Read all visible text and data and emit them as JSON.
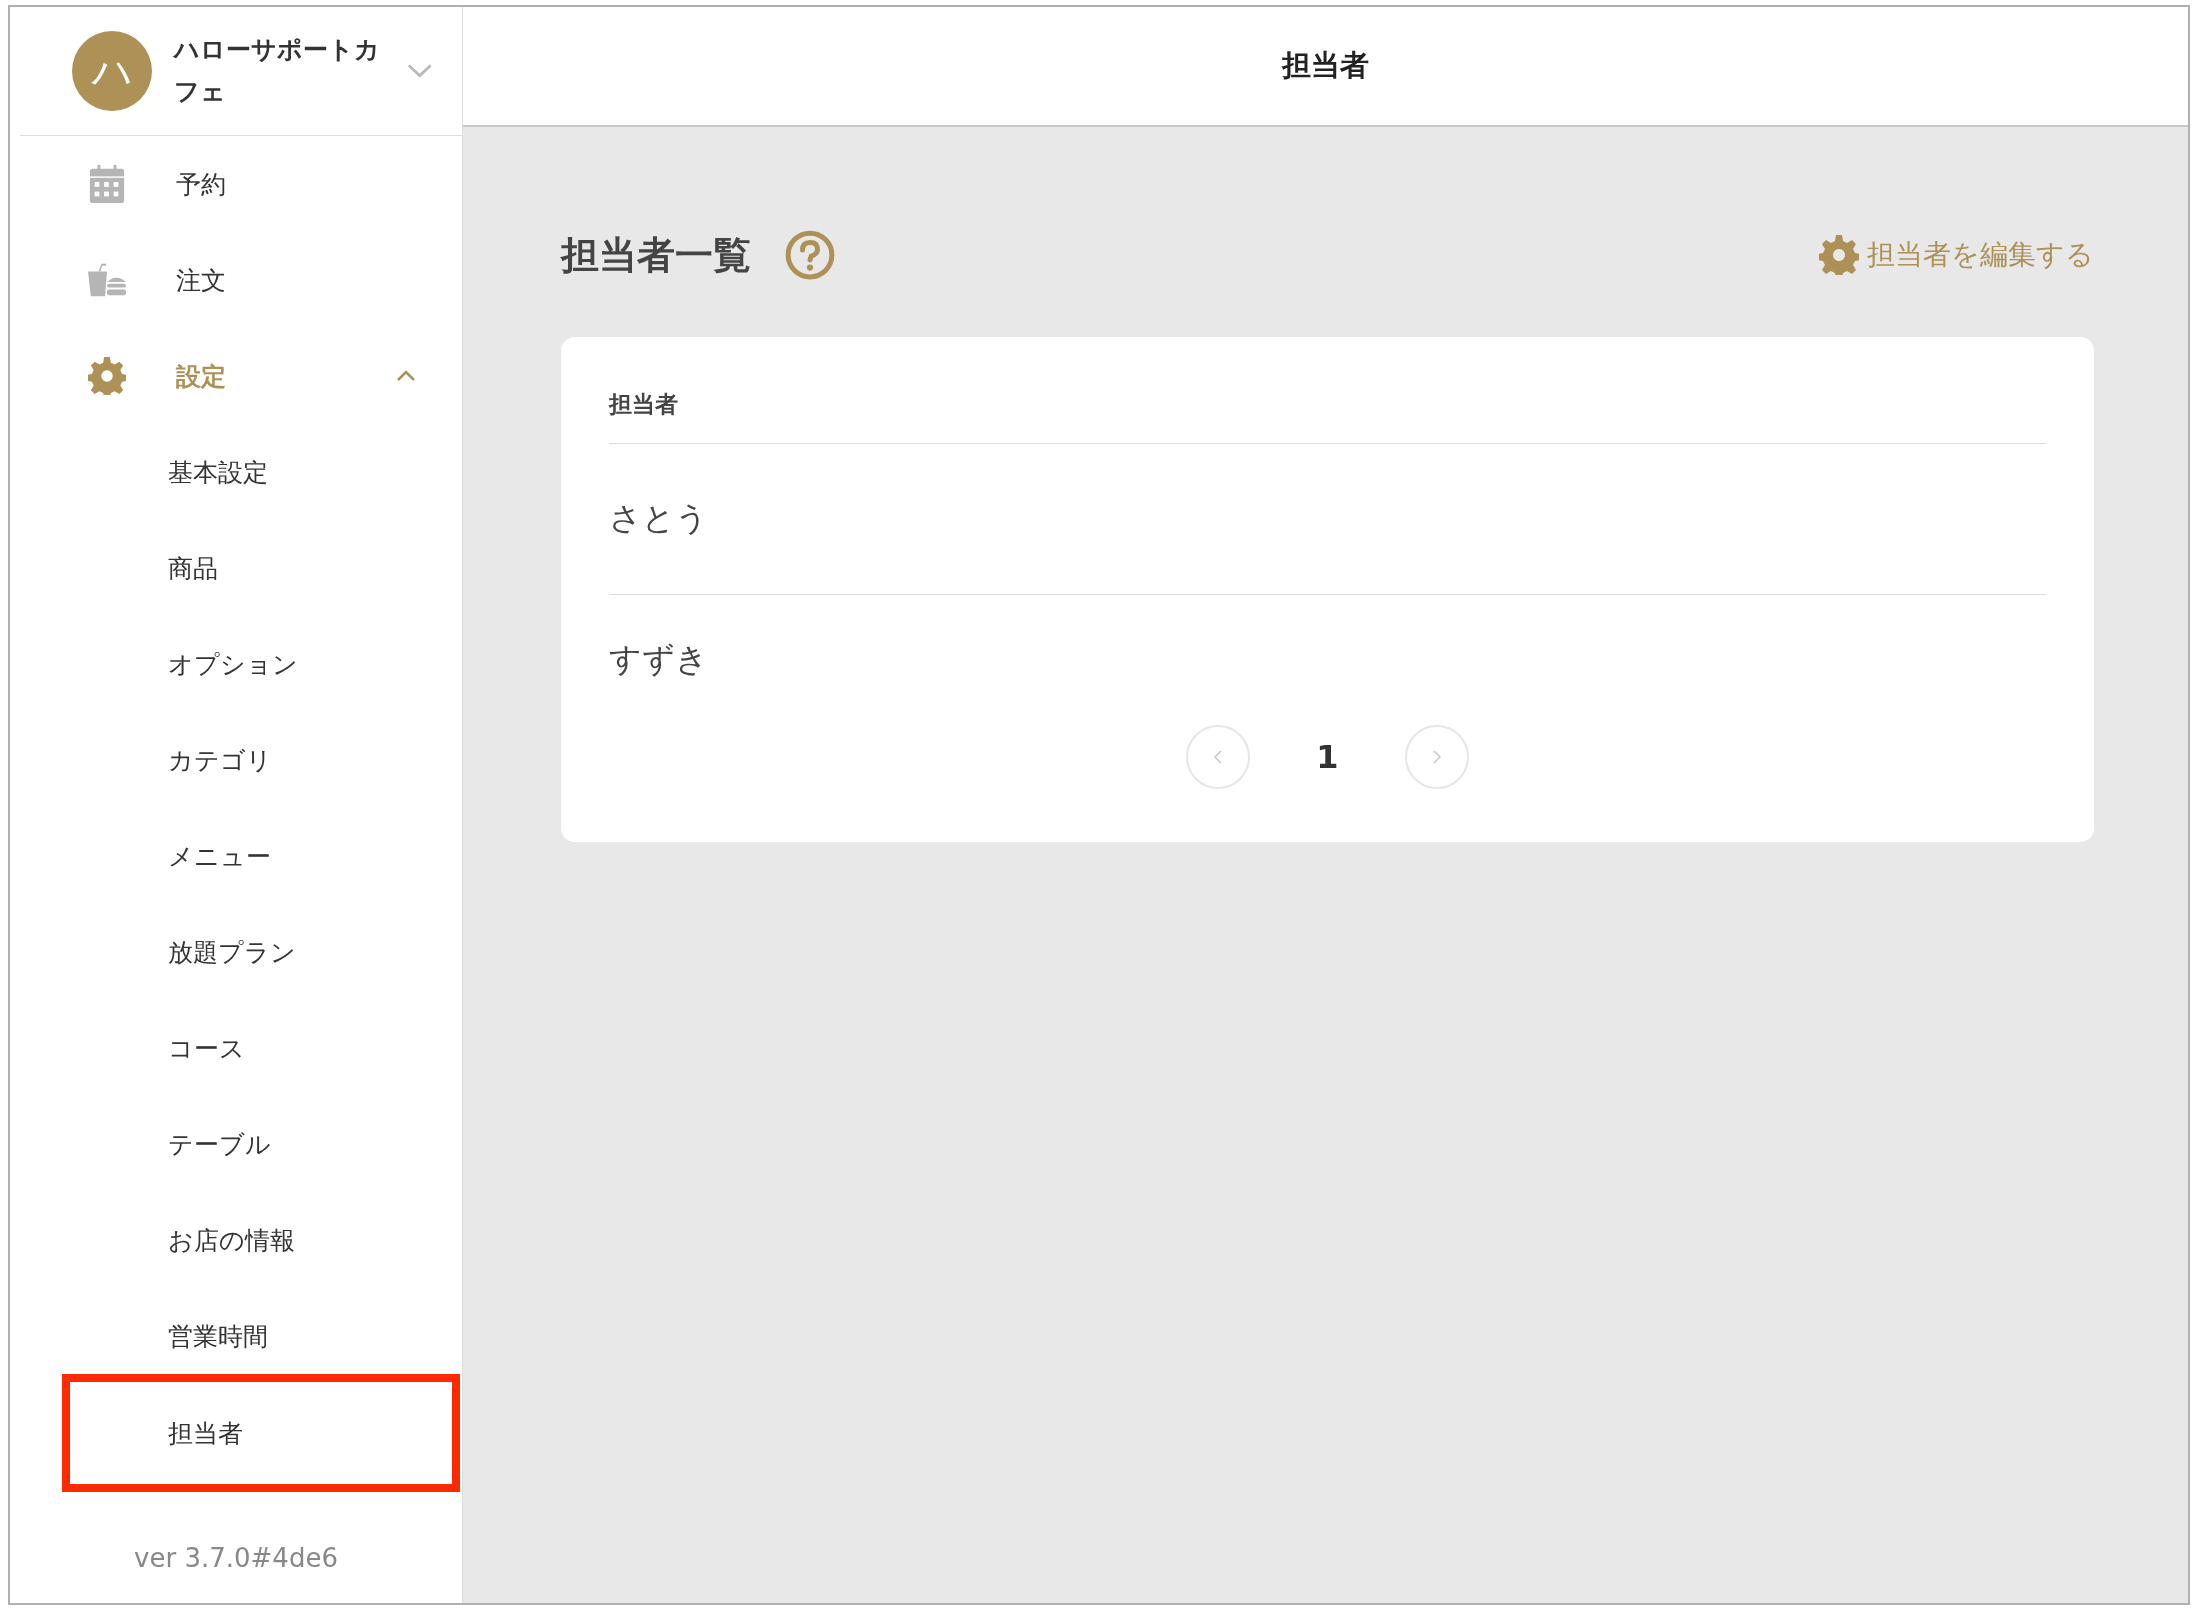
{
  "sidebar": {
    "store": {
      "avatar": "ハ",
      "name": "ハローサポートカフェ"
    },
    "nav": [
      {
        "kind": "calendar",
        "label": "予約",
        "selected": false
      },
      {
        "kind": "order",
        "label": "注文",
        "selected": false
      },
      {
        "kind": "settings",
        "label": "設定",
        "selected": true,
        "expanded": true,
        "children": [
          {
            "label": "基本設定",
            "selected": false
          },
          {
            "label": "商品",
            "selected": false
          },
          {
            "label": "オプション",
            "selected": false
          },
          {
            "label": "カテゴリ",
            "selected": false
          },
          {
            "label": "メニュー",
            "selected": false
          },
          {
            "label": "放題プラン",
            "selected": false
          },
          {
            "label": "コース",
            "selected": false
          },
          {
            "label": "テーブル",
            "selected": false
          },
          {
            "label": "お店の情報",
            "selected": false
          },
          {
            "label": "営業時間",
            "selected": false
          },
          {
            "label": "担当者",
            "selected": true
          }
        ]
      }
    ],
    "version": "ver 3.7.0#4de6"
  },
  "header": {
    "title": "担当者"
  },
  "content": {
    "title": "担当者一覧",
    "edit_link": "担当者を編集する",
    "table": {
      "columns": [
        "担当者"
      ],
      "rows": [
        "さとう",
        "すずき"
      ]
    },
    "pagination": {
      "pages": [
        {
          "label": "1",
          "selected": true
        }
      ]
    }
  }
}
